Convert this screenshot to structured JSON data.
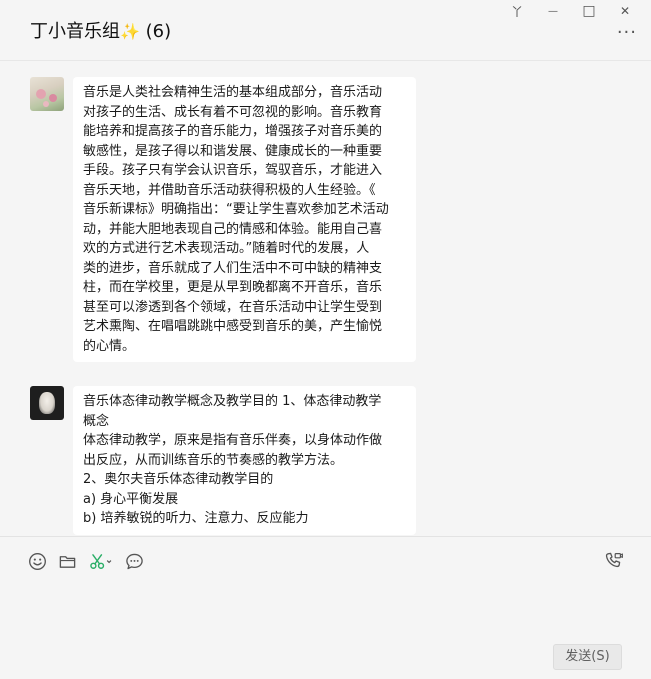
{
  "window": {
    "pin_glyph": "丫",
    "minimize_glyph": "—",
    "maximize_glyph": "□",
    "close_glyph": "✕"
  },
  "header": {
    "title": "丁小音乐组",
    "sparkle": "✨",
    "member_count": "(6)",
    "more_glyph": "···"
  },
  "messages": [
    {
      "lines": [
        "音乐是人类社会精神生活的基本组成部分，音乐活动",
        "对孩子的生活、成长有着不可忽视的影响。音乐教育",
        "能培养和提高孩子的音乐能力，增强孩子对音乐美的",
        "敏感性，是孩子得以和谐发展、健康成长的一种重要",
        "手段。孩子只有学会认识音乐，驾驭音乐，才能进入",
        "音乐天地，并借助音乐活动获得积极的人生经验。《",
        "音乐新课标》明确指出：“要让学生喜欢参加艺术活动",
        "动，并能大胆地表现自己的情感和体验。能用自己喜",
        "欢的方式进行艺术表现活动。”随着时代的发展，人",
        "类的进步，音乐就成了人们生活中不可中缺的精神支",
        "柱，而在学校里，更是从早到晚都离不开音乐，音乐",
        "甚至可以渗透到各个领域，在音乐活动中让学生受到",
        "艺术熏陶、在唱唱跳跳中感受到音乐的美，产生愉悦",
        "的心情。"
      ]
    },
    {
      "lines": [
        "音乐体态律动教学概念及教学目的 1、体态律动教学",
        "概念",
        "体态律动教学，原来是指有音乐伴奏，以身体动作做",
        "出反应，从而训练音乐的节奏感的教学方法。",
        "2、奥尔夫音乐体态律动教学目的",
        "a) 身心平衡发展",
        "b) 培养敏锐的听力、注意力、反应能力"
      ]
    }
  ],
  "toolbar": {
    "emoji_icon": "emoji-icon",
    "folder_icon": "folder-icon",
    "scissors_icon": "scissors-icon",
    "chat_icon": "chat-history-icon",
    "call_icon": "video-call-icon",
    "send_label": "发送(S)"
  },
  "colors": {
    "background": "#f5f5f5",
    "bubble": "#ffffff",
    "scissors_accent": "#2aae67",
    "sparkle": "#f3c14b"
  }
}
